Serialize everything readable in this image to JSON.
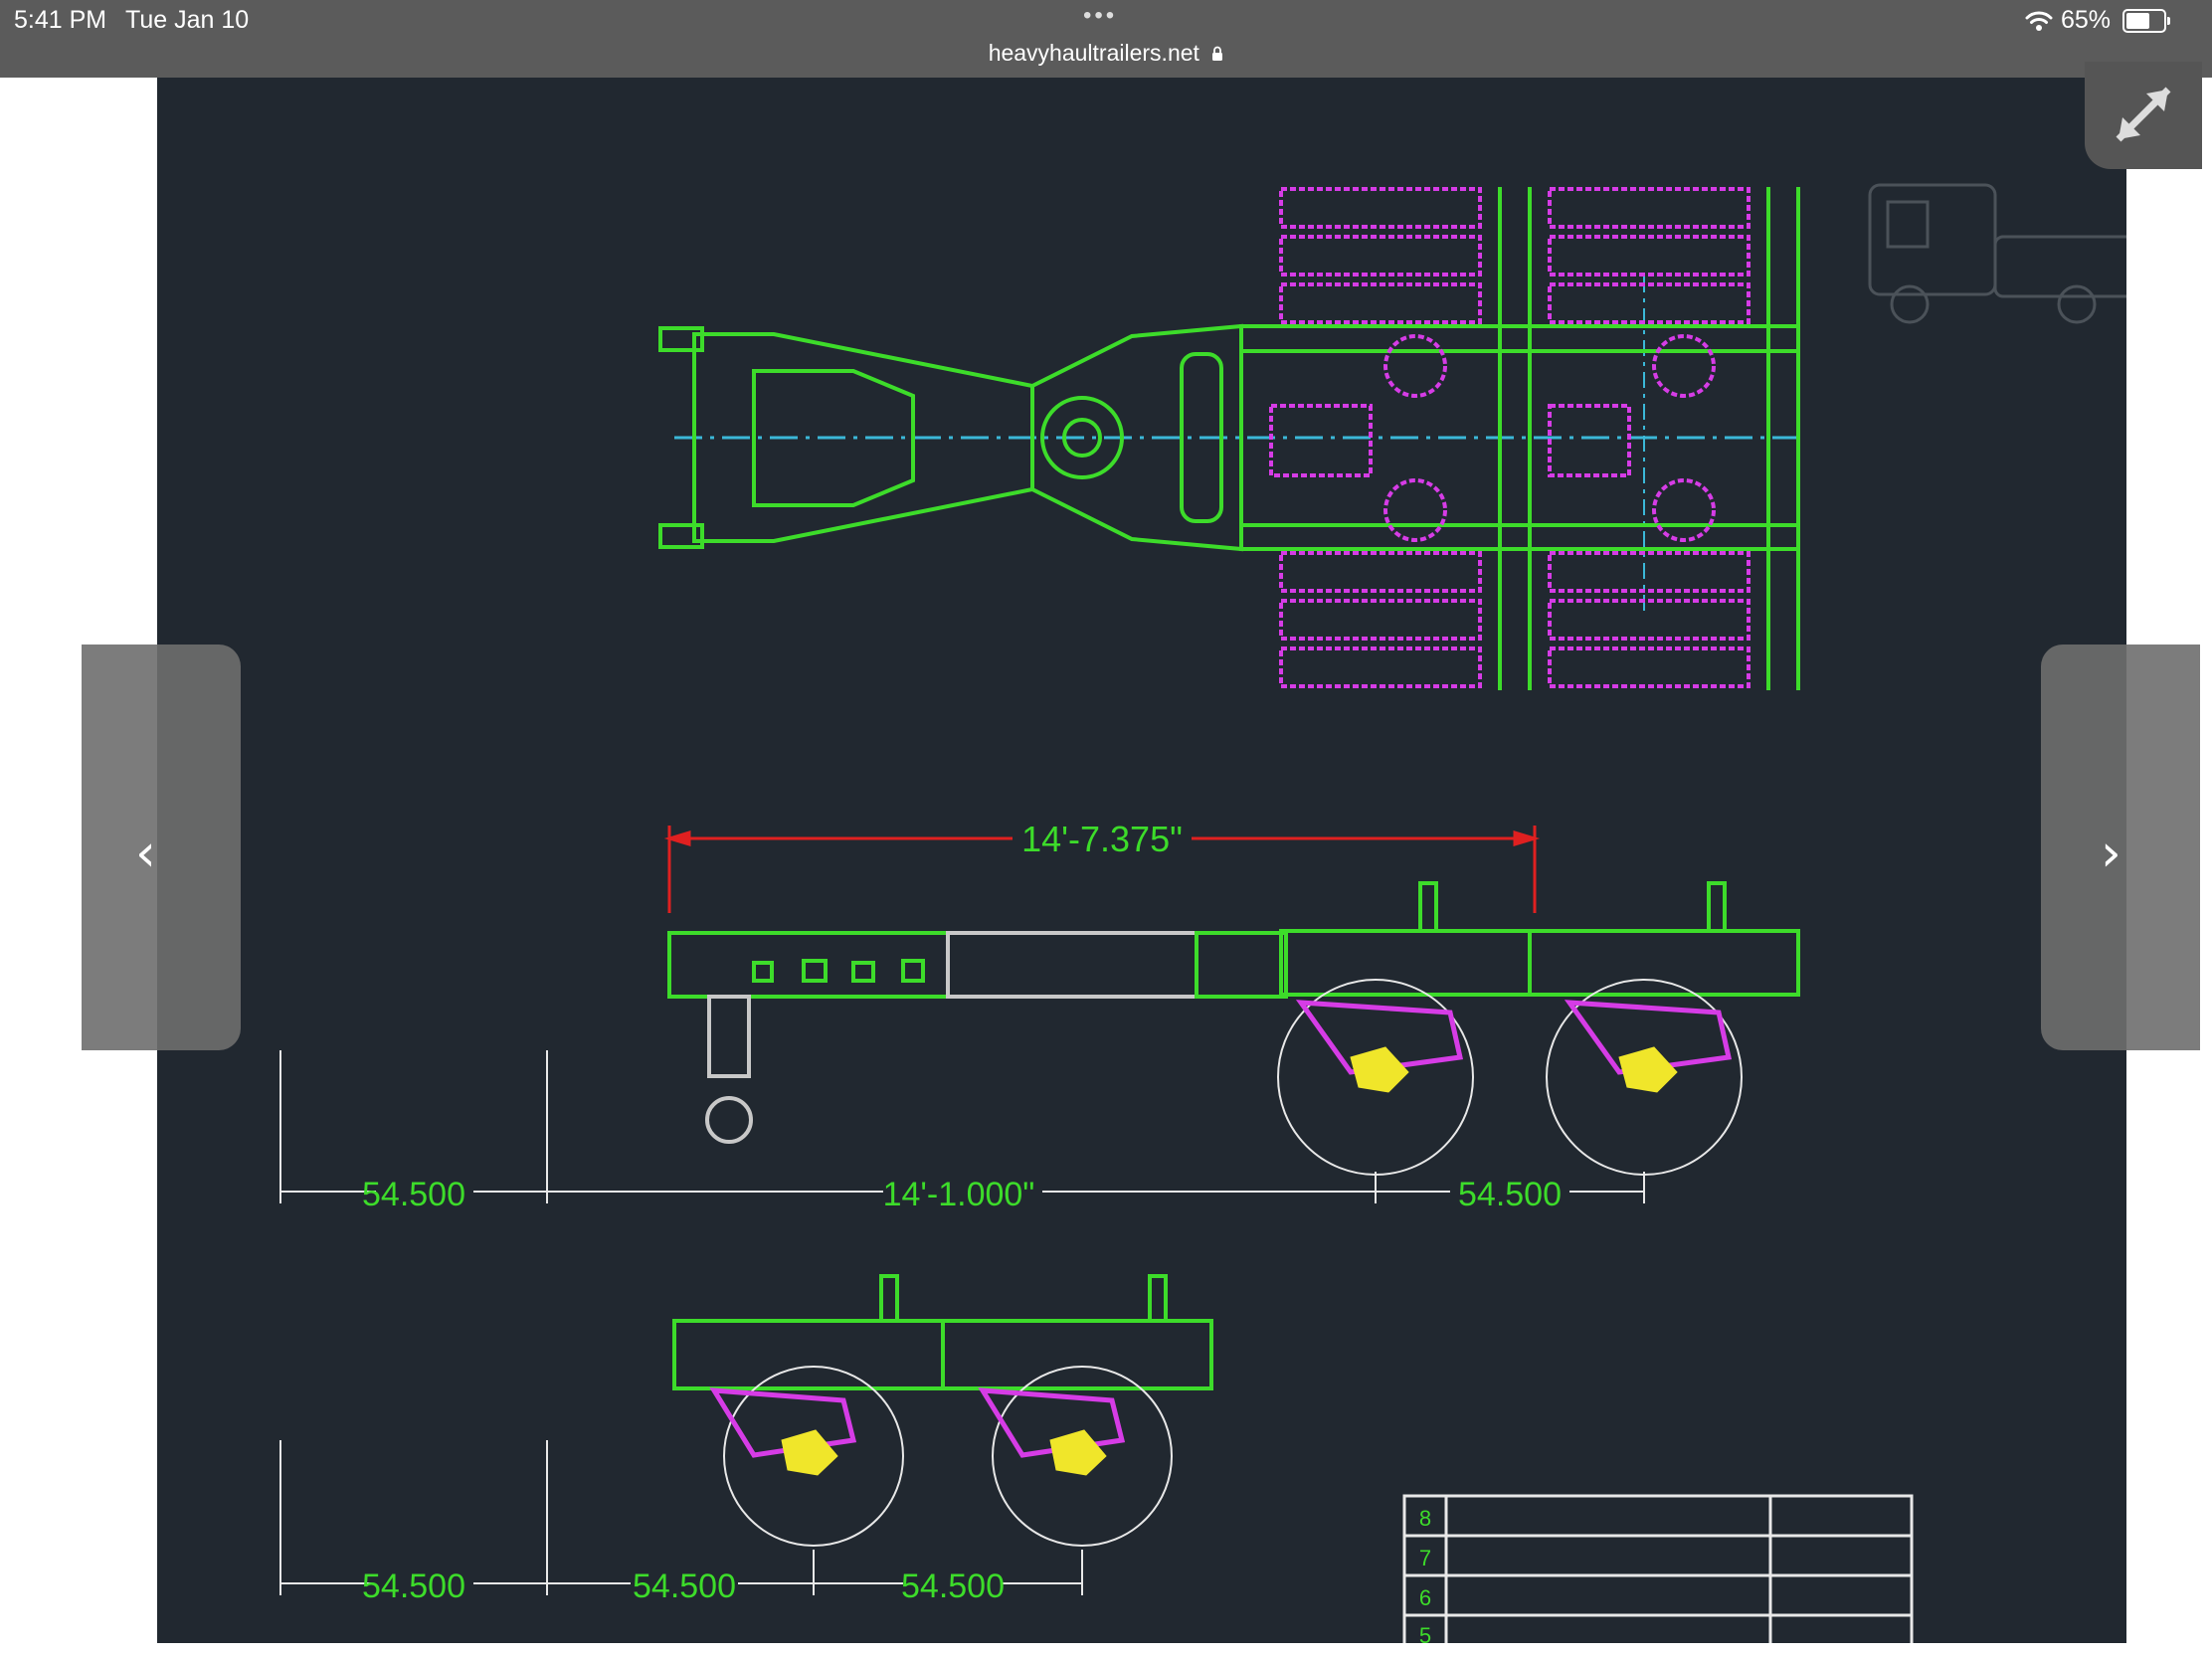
{
  "status_bar": {
    "time": "5:41 PM",
    "date": "Tue Jan 10",
    "dots": "•••",
    "url": "heavyhaultrailers.net",
    "lock_icon": "lock-icon",
    "wifi_icon": "wifi-icon",
    "battery_percent": "65%",
    "battery_level": 0.65
  },
  "drawing": {
    "dimensions": {
      "overall_length": "14'-7.375\"",
      "wheelbase": "14'-1.000\"",
      "spacing": "54.500"
    },
    "title_block_rows": [
      "8",
      "7",
      "6",
      "5"
    ]
  },
  "navigation": {
    "prev_icon": "chevron-left-icon",
    "next_icon": "chevron-right-icon",
    "expand_icon": "expand-icon"
  },
  "colors": {
    "frame": "#3ddc2a",
    "suspension": "#d63ce6",
    "dimension": "#e02020",
    "centerline": "#3bb8d8",
    "background": "#212830"
  }
}
